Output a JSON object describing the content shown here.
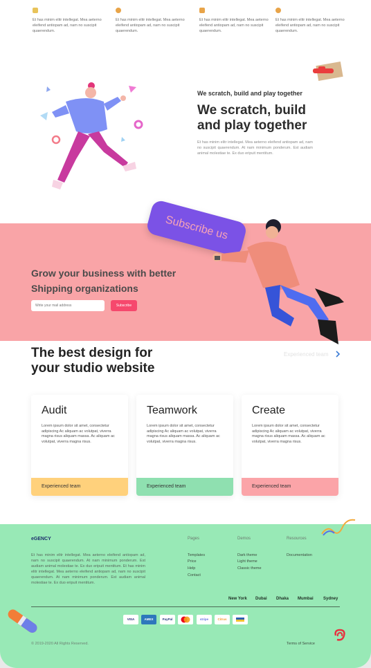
{
  "features": [
    {
      "text": "Et has minim elitr intellegat. Mea aeterno eleifend antiopam ad, nam no suscipit quaerendum.",
      "color": "#e8c35a"
    },
    {
      "text": "Et has minim elitr intellegat. Mea aeterno eleifend antiopam ad, nam no suscipit quaerendum.",
      "color": "#e8a449"
    },
    {
      "text": "Et has minim elitr intellegat. Mea aeterno eleifend antiopam ad, nam no suscipit quaerendum.",
      "color": "#e8a449"
    },
    {
      "text": "Et has minim elitr intellegat. Mea aeterno eleifend antiopam ad, nam no suscipit quaerendum.",
      "color": "#e8a449"
    }
  ],
  "scratch": {
    "eyebrow": "We scratch, build and play together",
    "title": "We scratch, build and play together",
    "body": "Et has minim elitr intellegat. Mea aeterno eleifend antiopam ad, nam no suscipit quaerendum. At nam minimum ponderum. Est audiam animal molestiae te. Ex duo eripuit mentitum."
  },
  "subscribe": {
    "sign": "Subscribe us",
    "headline": "Grow your business with better Shipping organizations",
    "email_placeholder": "Write your mail address",
    "button": "Subscribe"
  },
  "design": {
    "title": "The best design for your studio website",
    "link": "Experienced team",
    "link_icon": "chevron-right-icon"
  },
  "cards": [
    {
      "title": "Audit",
      "body": "Lorem ipsum dolor sit amet, consectetur adipiscing Ac aliquam ac volutpat, viverra magna risus aliquam massa. Ac aliquam ac volutpat, viverra magna risus.",
      "bar": "Experienced team",
      "color": "#ffd17c"
    },
    {
      "title": "Teamwork",
      "body": "Lorem ipsum dolor sit amet, consectetur adipiscing Ac aliquam ac volutpat, viverra magna risus aliquam massa. Ac aliquam ac volutpat, viverra magna risus.",
      "bar": "Experienced team",
      "color": "#8fe0b0"
    },
    {
      "title": "Create",
      "body": "Lorem ipsum dolor sit amet, consectetur adipiscing Ac aliquam ac volutpat, viverra magna risus aliquam massa. Ac aliquam ac volutpat, viverra magna risus.",
      "bar": "Experienced team",
      "color": "#fba4a8"
    }
  ],
  "footer": {
    "brand": "eGENCY",
    "about": "Et has minim elitr intellegat. Mea aeterno eleifend antiopam ad, nam no suscipit quaerendum. At nam minimum ponderum. Est audiam animal molestiae te. Ex duo eripuit mentitum. Et has minim elitr intellegat. Mea aeterno eleifend antiopam ad, nam no suscipit quaerendum. At nam minimum ponderum. Est audiam animal molestiae te. Ex duo eripuit mentitum.",
    "columns": [
      {
        "heading": "Pages",
        "links": [
          "Templates",
          "Price",
          "Help",
          "Contact"
        ]
      },
      {
        "heading": "Demos",
        "links": [
          "Dark theme",
          "Light theme",
          "Classic theme"
        ]
      },
      {
        "heading": "Resources",
        "links": [
          "Documentation"
        ]
      }
    ],
    "cities": [
      "New York",
      "Dubai",
      "Dhaka",
      "Mumbai",
      "Sydney"
    ],
    "payments": [
      "VISA",
      "AMEX",
      "PayPal",
      "MC",
      "stripe",
      "Citrus",
      "Card"
    ],
    "copyright": "© 2019-2020 All Rights Reserved.",
    "terms": "Terms of Service"
  },
  "colors": {
    "accent": "#f6486d",
    "pink_band": "#f9a4a7",
    "footer_green": "#98e9b6",
    "sign_purple": "#7b52e6"
  }
}
